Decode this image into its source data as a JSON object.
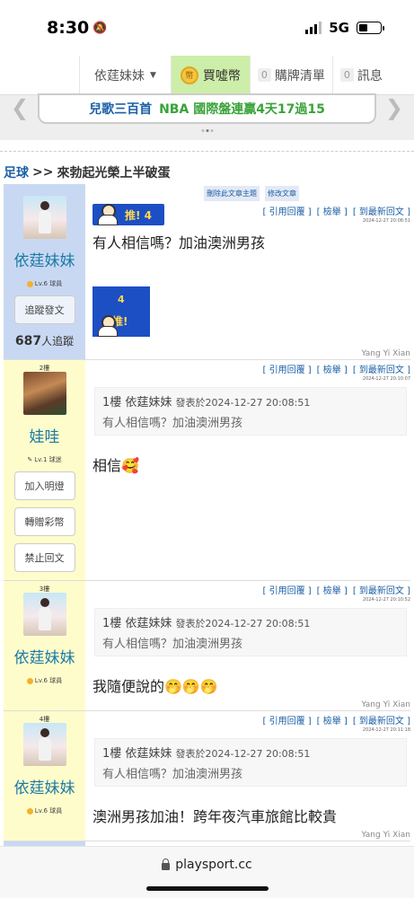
{
  "status": {
    "time": "8:30",
    "network": "5G"
  },
  "nav": {
    "user": "依莛妹妹",
    "coin_label": "買噓幣",
    "coin_icon_text": "幣",
    "buy_list_count": "0",
    "buy_list_label": "購牌清單",
    "msg_count": "0",
    "msg_label": "訊息"
  },
  "banner": {
    "part1": "兒歌三百首",
    "part2": "NBA 國際盤連贏4天17過15",
    "part3": ""
  },
  "breadcrumb": {
    "category": "足球",
    "separator": ">>",
    "title": "來勃起光榮上半破蛋"
  },
  "admin_links": {
    "delete_topic": "刪除此文章主題",
    "edit_post": "修改文章"
  },
  "actions": {
    "quote": "[ 引用回覆 ]",
    "report": "[ 檢舉 ]",
    "latest": "[ 到最新回文 ]"
  },
  "posts": [
    {
      "floor": "",
      "author": "依莛妹妹",
      "level": "Lv.6 球員",
      "buttons": [
        "追蹤發文"
      ],
      "follow_count": "687",
      "follow_suffix": "人追蹤",
      "timestamp": "2024-12-27 20:08:51",
      "badge_text": "推!",
      "badge_num": "4",
      "body": "有人相信嗎？加油澳洲男孩",
      "signer": "Yang Yi Xian"
    },
    {
      "floor": "2樓",
      "author": "娃哇",
      "level": "Lv.1 球迷",
      "buttons": [
        "加入明燈",
        "轉贈彩幣",
        "禁止回文"
      ],
      "timestamp": "2024-12-27 20:10:07",
      "quote_head": "1樓 依莛妹妹",
      "quote_meta": "發表於2024-12-27 20:08:51",
      "quote_body": "有人相信嗎？加油澳洲男孩",
      "body": "相信🥰"
    },
    {
      "floor": "3樓",
      "author": "依莛妹妹",
      "level": "Lv.6 球員",
      "timestamp": "2024-12-27 20:10:52",
      "quote_head": "1樓 依莛妹妹",
      "quote_meta": "發表於2024-12-27 20:08:51",
      "quote_body": "有人相信嗎？加油澳洲男孩",
      "body": "我隨便說的🤭🤭🤭",
      "signer": "Yang Yi Xian"
    },
    {
      "floor": "4樓",
      "author": "依莛妹妹",
      "level": "Lv.6 球員",
      "timestamp": "2024-12-27 20:11:18",
      "quote_head": "1樓 依莛妹妹",
      "quote_meta": "發表於2024-12-27 20:08:51",
      "quote_body": "有人相信嗎？加油澳洲男孩",
      "body": "澳洲男孩加油！跨年夜汽車旅館比較貴",
      "signer": "Yang Yi Xian"
    }
  ],
  "url": "playsport.cc"
}
